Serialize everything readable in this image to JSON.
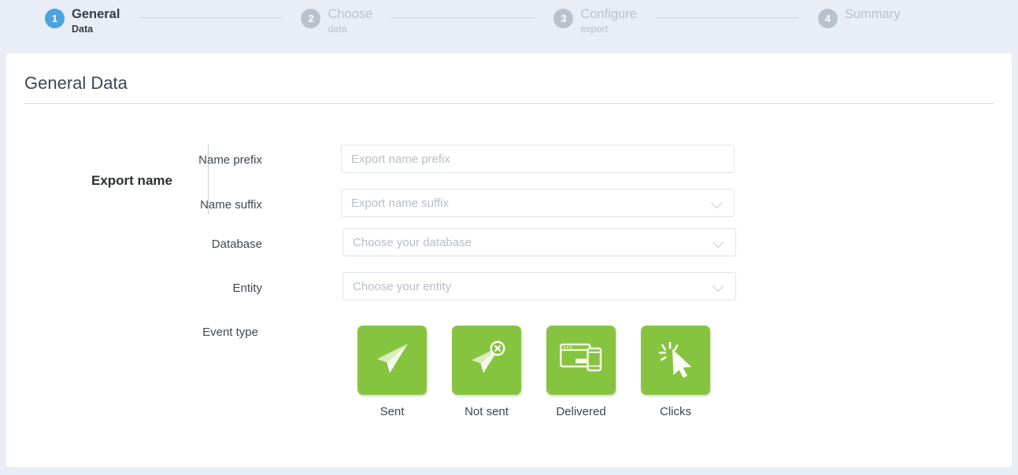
{
  "colors": {
    "page_background": "#e9edf5",
    "card_background": "#ffffff",
    "active_step": "#4aa3e0",
    "inactive_step": "#b9c2cc",
    "tile_green": "#86c440",
    "title_text": "#3d4650"
  },
  "stepper": {
    "steps": [
      {
        "number": "1",
        "title": "General",
        "subtitle": "Data",
        "state": "active"
      },
      {
        "number": "2",
        "title": "Choose",
        "subtitle": "data",
        "state": "inactive"
      },
      {
        "number": "3",
        "title": "Configure",
        "subtitle": "export",
        "state": "inactive"
      },
      {
        "number": "4",
        "title": "Summary",
        "subtitle": "",
        "state": "inactive"
      }
    ]
  },
  "page": {
    "title": "General Data"
  },
  "form": {
    "section_title": "Export name",
    "fields": [
      {
        "label": "Name prefix",
        "placeholder": "Export name prefix",
        "value": "",
        "type": "text",
        "name": "name-prefix"
      },
      {
        "label": "Name suffix",
        "placeholder": "Export name suffix",
        "value": "",
        "type": "select",
        "name": "name-suffix"
      },
      {
        "label": "Database",
        "placeholder": "Choose your database",
        "value": "",
        "type": "select",
        "name": "database"
      },
      {
        "label": "Entity",
        "placeholder": "Choose your entity",
        "value": "",
        "type": "select",
        "name": "entity"
      }
    ],
    "event_type": {
      "label": "Event type",
      "tiles": [
        {
          "label": "Sent",
          "icon": "paper-plane-icon"
        },
        {
          "label": "Not sent",
          "icon": "paper-plane-cancel-icon"
        },
        {
          "label": "Delivered",
          "icon": "devices-icon"
        },
        {
          "label": "Clicks",
          "icon": "cursor-click-icon"
        }
      ]
    }
  }
}
